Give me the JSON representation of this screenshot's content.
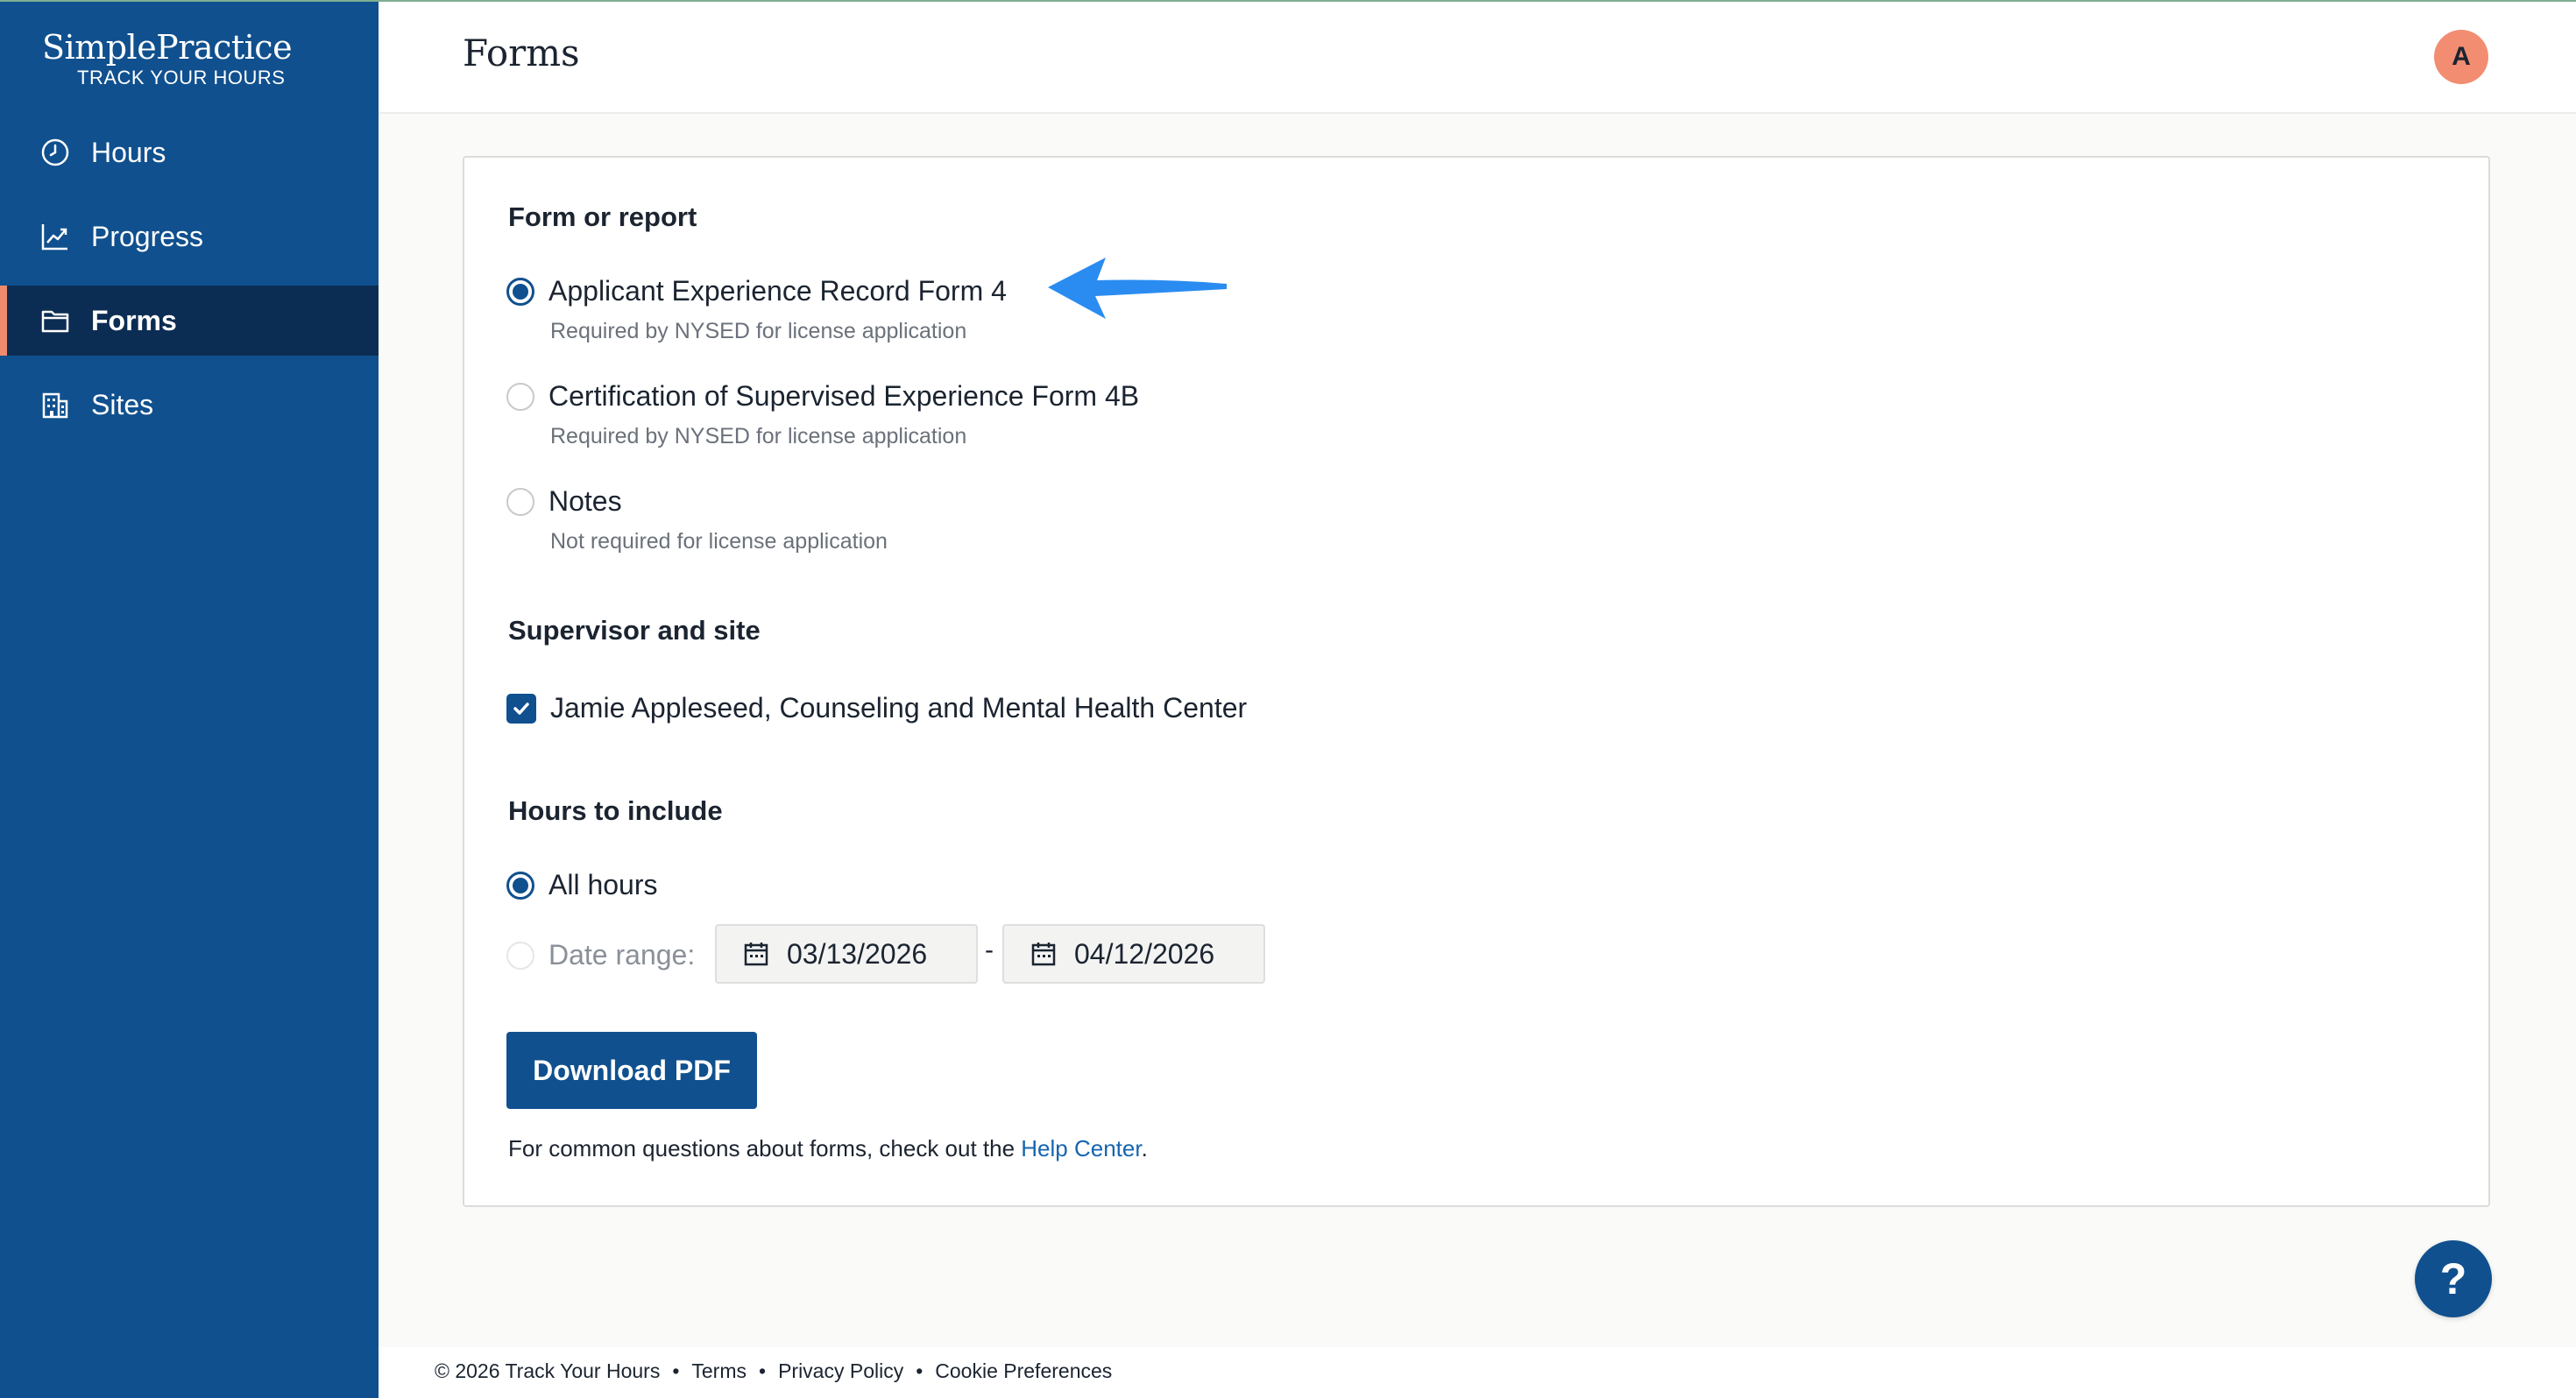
{
  "brand": {
    "name": "SimplePractice",
    "subtitle": "TRACK YOUR HOURS"
  },
  "sidebar": {
    "items": [
      {
        "label": "Hours",
        "icon": "clock-icon",
        "active": false
      },
      {
        "label": "Progress",
        "icon": "chart-line-icon",
        "active": false
      },
      {
        "label": "Forms",
        "icon": "folder-icon",
        "active": true
      },
      {
        "label": "Sites",
        "icon": "building-icon",
        "active": false
      }
    ]
  },
  "header": {
    "title": "Forms",
    "avatar_initial": "A"
  },
  "form": {
    "section_form_title": "Form or report",
    "options": [
      {
        "label": "Applicant Experience Record Form 4",
        "description": "Required by NYSED for license application",
        "selected": true
      },
      {
        "label": "Certification of Supervised Experience Form 4B",
        "description": "Required by NYSED for license application",
        "selected": false
      },
      {
        "label": "Notes",
        "description": "Not required for license application",
        "selected": false
      }
    ],
    "section_supervisor_title": "Supervisor and site",
    "supervisor_label": "Jamie Appleseed, Counseling and Mental Health Center",
    "supervisor_checked": true,
    "section_hours_title": "Hours to include",
    "hours_all_label": "All hours",
    "hours_range_label": "Date range:",
    "date_start": "03/13/2026",
    "date_separator": "-",
    "date_end": "04/12/2026",
    "download_label": "Download PDF",
    "help_prefix": "For common questions about forms, check out the ",
    "help_link": "Help Center",
    "help_suffix": "."
  },
  "help_button": {
    "label": "?"
  },
  "footer": {
    "copyright": "© 2026 Track Your Hours",
    "separator": "•",
    "links": [
      "Terms",
      "Privacy Policy",
      "Cookie Preferences"
    ]
  },
  "colors": {
    "sidebar": "#10508e",
    "sidebar_active": "#0c2d53",
    "accent": "#f08a6c",
    "primary": "#10508e",
    "link": "#1665b0",
    "arrow": "#2a8cf0"
  }
}
